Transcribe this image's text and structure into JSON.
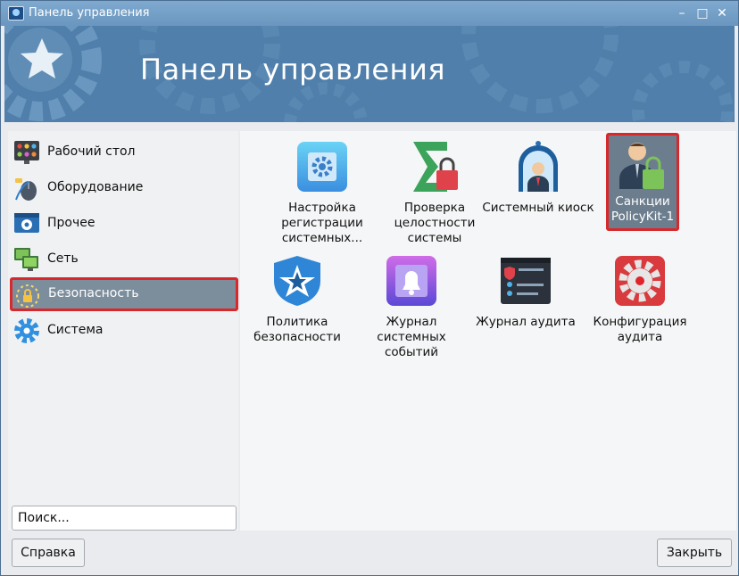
{
  "window": {
    "title": "Панель управления",
    "minimize": "–",
    "maximize": "□",
    "close": "✕"
  },
  "banner": {
    "title": "Панель управления"
  },
  "sidebar": {
    "items": [
      {
        "label": "Рабочий стол",
        "icon": "desktop-grid-icon"
      },
      {
        "label": "Оборудование",
        "icon": "mouse-icon"
      },
      {
        "label": "Прочее",
        "icon": "window-gear-icon"
      },
      {
        "label": "Сеть",
        "icon": "network-monitors-icon"
      },
      {
        "label": "Безопасность",
        "icon": "security-lock-icon",
        "selected": true
      },
      {
        "label": "Система",
        "icon": "gear-icon"
      }
    ]
  },
  "search": {
    "value": "Поиск..."
  },
  "main": {
    "tiles": [
      {
        "label": "Настройка регистрации системных...",
        "icon": "settings-registration-icon"
      },
      {
        "label": "Проверка целостности системы",
        "icon": "integrity-check-icon"
      },
      {
        "label": "Системный киоск",
        "icon": "kiosk-icon"
      },
      {
        "label": "Санкции PolicyKit-1",
        "icon": "policykit-user-lock-icon",
        "selected": true
      },
      {
        "label": "Политика безопасности",
        "icon": "security-policy-shield-icon"
      },
      {
        "label": "Журнал системных событий",
        "icon": "event-log-bell-icon"
      },
      {
        "label": "Журнал аудита",
        "icon": "audit-log-terminal-icon"
      },
      {
        "label": "Конфигурация аудита",
        "icon": "audit-config-gear-icon"
      }
    ]
  },
  "buttons": {
    "help": "Справка",
    "close": "Закрыть"
  },
  "colors": {
    "accent": "#6d9ac0",
    "selection_border": "#d8282b",
    "selection_bg": "#7c8e9c"
  }
}
